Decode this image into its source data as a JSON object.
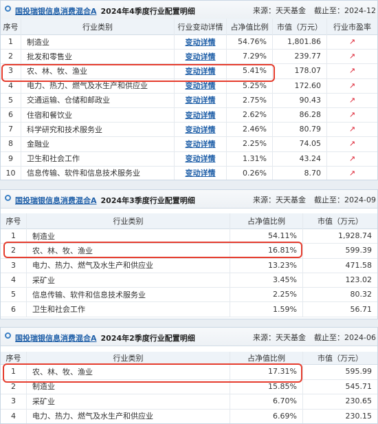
{
  "p1": {
    "fund_name": "国投瑞银信息消费混合A",
    "quarter_title": "2024年4季度行业配置明细",
    "source": "来源：天天基金",
    "cutoff": "截止至：2024-12",
    "headers": {
      "no": "序号",
      "industry": "行业类别",
      "change": "行业变动详情",
      "ratio": "占净值比例",
      "value": "市值（万元）",
      "pe": "行业市盈率"
    },
    "rows": [
      {
        "no": "1",
        "industry": "制造业",
        "change": "变动详情",
        "ratio": "54.76%",
        "value": "1,801.86",
        "pe": "↗"
      },
      {
        "no": "2",
        "industry": "批发和零售业",
        "change": "变动详情",
        "ratio": "7.29%",
        "value": "239.77",
        "pe": "↗"
      },
      {
        "no": "3",
        "industry": "农、林、牧、渔业",
        "change": "变动详情",
        "ratio": "5.41%",
        "value": "178.07",
        "pe": "↗"
      },
      {
        "no": "4",
        "industry": "电力、热力、燃气及水生产和供应业",
        "change": "变动详情",
        "ratio": "5.25%",
        "value": "172.60",
        "pe": "↗"
      },
      {
        "no": "5",
        "industry": "交通运输、仓储和邮政业",
        "change": "变动详情",
        "ratio": "2.75%",
        "value": "90.43",
        "pe": "↗"
      },
      {
        "no": "6",
        "industry": "住宿和餐饮业",
        "change": "变动详情",
        "ratio": "2.62%",
        "value": "86.28",
        "pe": "↗"
      },
      {
        "no": "7",
        "industry": "科学研究和技术服务业",
        "change": "变动详情",
        "ratio": "2.46%",
        "value": "80.79",
        "pe": "↗"
      },
      {
        "no": "8",
        "industry": "金融业",
        "change": "变动详情",
        "ratio": "2.25%",
        "value": "74.05",
        "pe": "↗"
      },
      {
        "no": "9",
        "industry": "卫生和社会工作",
        "change": "变动详情",
        "ratio": "1.31%",
        "value": "43.24",
        "pe": "↗"
      },
      {
        "no": "10",
        "industry": "信息传输、软件和信息技术服务业",
        "change": "变动详情",
        "ratio": "0.26%",
        "value": "8.70",
        "pe": "↗"
      }
    ]
  },
  "p2": {
    "fund_name": "国投瑞银信息消费混合A",
    "quarter_title": "2024年3季度行业配置明细",
    "source": "来源：天天基金",
    "cutoff": "截止至：2024-09",
    "headers": {
      "no": "序号",
      "industry": "行业类别",
      "ratio": "占净值比例",
      "value": "市值（万元）"
    },
    "rows": [
      {
        "no": "1",
        "industry": "制造业",
        "ratio": "54.11%",
        "value": "1,928.74"
      },
      {
        "no": "2",
        "industry": "农、林、牧、渔业",
        "ratio": "16.81%",
        "value": "599.39"
      },
      {
        "no": "3",
        "industry": "电力、热力、燃气及水生产和供应业",
        "ratio": "13.23%",
        "value": "471.58"
      },
      {
        "no": "4",
        "industry": "采矿业",
        "ratio": "3.45%",
        "value": "123.02"
      },
      {
        "no": "5",
        "industry": "信息传输、软件和信息技术服务业",
        "ratio": "2.25%",
        "value": "80.32"
      },
      {
        "no": "6",
        "industry": "卫生和社会工作",
        "ratio": "1.59%",
        "value": "56.71"
      }
    ]
  },
  "p3": {
    "fund_name": "国投瑞银信息消费混合A",
    "quarter_title": "2024年2季度行业配置明细",
    "source": "来源：天天基金",
    "cutoff": "截止至：2024-06",
    "headers": {
      "no": "序号",
      "industry": "行业类别",
      "ratio": "占净值比例",
      "value": "市值（万元）"
    },
    "rows": [
      {
        "no": "1",
        "industry": "农、林、牧、渔业",
        "ratio": "17.31%",
        "value": "595.99"
      },
      {
        "no": "2",
        "industry": "制造业",
        "ratio": "15.85%",
        "value": "545.71"
      },
      {
        "no": "3",
        "industry": "采矿业",
        "ratio": "6.70%",
        "value": "230.65"
      },
      {
        "no": "4",
        "industry": "电力、热力、燃气及水生产和供应业",
        "ratio": "6.69%",
        "value": "230.15"
      }
    ]
  },
  "colors": {
    "link": "#1f5fa8",
    "highlight": "#e53b2c",
    "header_bg": "#eef3f8"
  }
}
